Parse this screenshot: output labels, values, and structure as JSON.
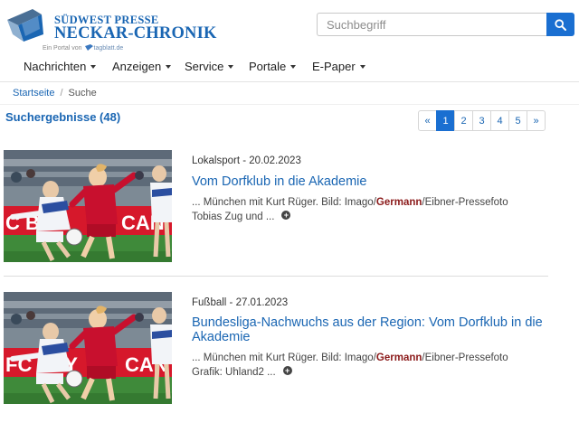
{
  "brand": {
    "top_text": "SÜDWEST PRESSE",
    "main_text": "NECKAR-CHRONIK",
    "portal_prefix": "Ein Portal von",
    "portal_name": "tagblatt.de",
    "color": "#1a66b3"
  },
  "search": {
    "placeholder": "Suchbegriff",
    "button_icon": "search-icon",
    "button_color": "#1a6fd1"
  },
  "nav": {
    "items": [
      {
        "label": "Nachrichten"
      },
      {
        "label": "Anzeigen"
      },
      {
        "label": "Service"
      },
      {
        "label": "Portale"
      },
      {
        "label": "E-Paper"
      }
    ]
  },
  "breadcrumb": {
    "home": "Startseite",
    "separator": "/",
    "current": "Suche"
  },
  "results": {
    "title": "Suchergebnisse (48)"
  },
  "pagination": {
    "prev": "«",
    "pages": [
      "1",
      "2",
      "3",
      "4",
      "5"
    ],
    "next": "»",
    "active": "1"
  },
  "articles": [
    {
      "meta": "Lokalsport - 20.02.2023",
      "headline": "Vom Dorfklub in die Akademie",
      "snippet_before": "... München mit Kurt Rüger. Bild: Imago/",
      "snippet_highlight": "Germann",
      "snippet_after": "/Eibner-Pressefoto",
      "snippet_line2": "Tobias Zug und ...",
      "more_icon": "plus-circle-icon"
    },
    {
      "meta": "Fußball - 27.01.2023",
      "headline": "Bundesliga-Nachwuchs aus der Region: Vom Dorfklub in die Akademie",
      "snippet_before": "... München mit Kurt Rüger. Bild: Imago/",
      "snippet_highlight": "Germann",
      "snippet_after": "/Eibner-Pressefoto",
      "snippet_line2": "Grafik: Uhland2 ...",
      "more_icon": "plus-circle-icon"
    }
  ]
}
